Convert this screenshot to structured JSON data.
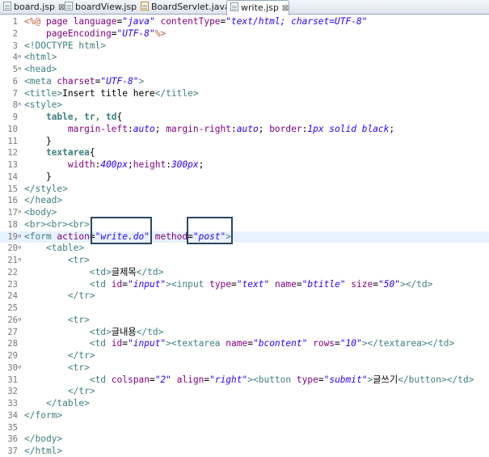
{
  "tabs": [
    {
      "name": "board.jsp",
      "close": "⊠",
      "type": "jsp"
    },
    {
      "name": "boardView.jsp",
      "close": "",
      "type": "jsp"
    },
    {
      "name": "BoardServlet.java",
      "close": "",
      "type": "java"
    },
    {
      "name": "write.jsp",
      "close": "⊠",
      "type": "jsp",
      "active": true
    }
  ],
  "editor": {
    "current_line": 19,
    "lines": [
      {
        "n": "1",
        "fold": "",
        "segs": [
          [
            "dir",
            "<%@ "
          ],
          [
            "atn",
            "page "
          ],
          [
            "atn",
            "language"
          ],
          [
            "txt",
            "="
          ],
          [
            "atv",
            "\"java\""
          ],
          [
            "txt",
            " "
          ],
          [
            "atn",
            "contentType"
          ],
          [
            "txt",
            "="
          ],
          [
            "atv",
            "\"text/html; charset=UTF-8\""
          ]
        ]
      },
      {
        "n": "2",
        "fold": "",
        "segs": [
          [
            "txt",
            "    "
          ],
          [
            "atn",
            "pageEncoding"
          ],
          [
            "txt",
            "="
          ],
          [
            "atv",
            "\"UTF-8\""
          ],
          [
            "dir",
            "%>"
          ]
        ]
      },
      {
        "n": "3",
        "fold": "",
        "segs": [
          [
            "tag",
            "<!DOCTYPE html>"
          ]
        ]
      },
      {
        "n": "4",
        "fold": "⊖",
        "segs": [
          [
            "tag",
            "<html>"
          ]
        ]
      },
      {
        "n": "5",
        "fold": "⊖",
        "segs": [
          [
            "tag",
            "<head>"
          ]
        ]
      },
      {
        "n": "6",
        "fold": "",
        "segs": [
          [
            "tag",
            "<meta "
          ],
          [
            "atn",
            "charset"
          ],
          [
            "txt",
            "="
          ],
          [
            "atv",
            "\"UTF-8\""
          ],
          [
            "tag",
            ">"
          ]
        ]
      },
      {
        "n": "7",
        "fold": "",
        "segs": [
          [
            "tag",
            "<title>"
          ],
          [
            "txt",
            "Insert title here"
          ],
          [
            "tag",
            "</title>"
          ]
        ]
      },
      {
        "n": "8",
        "fold": "⊖",
        "segs": [
          [
            "tag",
            "<style>"
          ]
        ]
      },
      {
        "n": "9",
        "fold": "",
        "segs": [
          [
            "txt",
            "    "
          ],
          [
            "css",
            "table, tr, td"
          ],
          [
            "txt",
            "{"
          ]
        ]
      },
      {
        "n": "10",
        "fold": "",
        "segs": [
          [
            "txt",
            "        "
          ],
          [
            "pn",
            "margin-left"
          ],
          [
            "txt",
            ":"
          ],
          [
            "pv",
            "auto"
          ],
          [
            "txt",
            "; "
          ],
          [
            "pn",
            "margin-right"
          ],
          [
            "txt",
            ":"
          ],
          [
            "pv",
            "auto"
          ],
          [
            "txt",
            "; "
          ],
          [
            "pn",
            "border"
          ],
          [
            "txt",
            ":"
          ],
          [
            "pv",
            "1px solid black"
          ],
          [
            "txt",
            ";"
          ]
        ]
      },
      {
        "n": "11",
        "fold": "",
        "segs": [
          [
            "txt",
            "    }"
          ]
        ]
      },
      {
        "n": "12",
        "fold": "",
        "segs": [
          [
            "txt",
            "    "
          ],
          [
            "css",
            "textarea"
          ],
          [
            "txt",
            "{"
          ]
        ]
      },
      {
        "n": "13",
        "fold": "",
        "segs": [
          [
            "txt",
            "        "
          ],
          [
            "pn",
            "width"
          ],
          [
            "txt",
            ":"
          ],
          [
            "pv",
            "400px"
          ],
          [
            "txt",
            ";"
          ],
          [
            "pn",
            "height"
          ],
          [
            "txt",
            ":"
          ],
          [
            "pv",
            "300px"
          ],
          [
            "txt",
            ";"
          ]
        ]
      },
      {
        "n": "14",
        "fold": "",
        "segs": [
          [
            "txt",
            "    }"
          ]
        ]
      },
      {
        "n": "15",
        "fold": "",
        "segs": [
          [
            "tag",
            "</style>"
          ]
        ]
      },
      {
        "n": "16",
        "fold": "",
        "segs": [
          [
            "tag",
            "</head>"
          ]
        ]
      },
      {
        "n": "17",
        "fold": "⊖",
        "segs": [
          [
            "tag",
            "<body>"
          ]
        ]
      },
      {
        "n": "18",
        "fold": "",
        "segs": [
          [
            "tag",
            "<br><br><br>"
          ]
        ]
      },
      {
        "n": "19",
        "fold": "⊖",
        "segs": [
          [
            "tag",
            "<form "
          ],
          [
            "atn",
            "action"
          ],
          [
            "txt",
            "="
          ],
          [
            "atv",
            "\"write.do\""
          ],
          [
            "txt",
            " "
          ],
          [
            "atn",
            "method"
          ],
          [
            "txt",
            "="
          ],
          [
            "atv",
            "\"post\""
          ],
          [
            "tag",
            ">"
          ]
        ]
      },
      {
        "n": "20",
        "fold": "⊖",
        "segs": [
          [
            "txt",
            "    "
          ],
          [
            "tag",
            "<table>"
          ]
        ]
      },
      {
        "n": "21",
        "fold": "⊖",
        "segs": [
          [
            "txt",
            "        "
          ],
          [
            "tag",
            "<tr>"
          ]
        ]
      },
      {
        "n": "22",
        "fold": "",
        "segs": [
          [
            "txt",
            "            "
          ],
          [
            "tag",
            "<td>"
          ],
          [
            "txt",
            "글제목"
          ],
          [
            "tag",
            "</td>"
          ]
        ]
      },
      {
        "n": "23",
        "fold": "",
        "segs": [
          [
            "txt",
            "            "
          ],
          [
            "tag",
            "<td "
          ],
          [
            "atn",
            "id"
          ],
          [
            "txt",
            "="
          ],
          [
            "atv",
            "\"input\""
          ],
          [
            "tag",
            ">"
          ],
          [
            "tag",
            "<input "
          ],
          [
            "atn",
            "type"
          ],
          [
            "txt",
            "="
          ],
          [
            "atv",
            "\"text\""
          ],
          [
            "txt",
            " "
          ],
          [
            "atn",
            "name"
          ],
          [
            "txt",
            "="
          ],
          [
            "atv",
            "\"btitle\""
          ],
          [
            "txt",
            " "
          ],
          [
            "atn",
            "size"
          ],
          [
            "txt",
            "="
          ],
          [
            "atv",
            "\"50\""
          ],
          [
            "tag",
            ">"
          ],
          [
            "tag",
            "</td>"
          ]
        ]
      },
      {
        "n": "24",
        "fold": "",
        "segs": [
          [
            "txt",
            "        "
          ],
          [
            "tag",
            "</tr>"
          ]
        ]
      },
      {
        "n": "25",
        "fold": "",
        "segs": []
      },
      {
        "n": "26",
        "fold": "⊖",
        "segs": [
          [
            "txt",
            "        "
          ],
          [
            "tag",
            "<tr>"
          ]
        ]
      },
      {
        "n": "27",
        "fold": "",
        "segs": [
          [
            "txt",
            "            "
          ],
          [
            "tag",
            "<td>"
          ],
          [
            "txt",
            "글내용"
          ],
          [
            "tag",
            "</td>"
          ]
        ]
      },
      {
        "n": "28",
        "fold": "",
        "segs": [
          [
            "txt",
            "            "
          ],
          [
            "tag",
            "<td "
          ],
          [
            "atn",
            "id"
          ],
          [
            "txt",
            "="
          ],
          [
            "atv",
            "\"input\""
          ],
          [
            "tag",
            ">"
          ],
          [
            "tag",
            "<textarea "
          ],
          [
            "atn",
            "name"
          ],
          [
            "txt",
            "="
          ],
          [
            "atv",
            "\"bcontent\""
          ],
          [
            "txt",
            " "
          ],
          [
            "atn",
            "rows"
          ],
          [
            "txt",
            "="
          ],
          [
            "atv",
            "\"10\""
          ],
          [
            "tag",
            ">"
          ],
          [
            "tag",
            "</textarea>"
          ],
          [
            "tag",
            "</td>"
          ]
        ]
      },
      {
        "n": "29",
        "fold": "",
        "segs": [
          [
            "txt",
            "        "
          ],
          [
            "tag",
            "</tr>"
          ]
        ]
      },
      {
        "n": "30",
        "fold": "⊖",
        "segs": [
          [
            "txt",
            "        "
          ],
          [
            "tag",
            "<tr>"
          ]
        ]
      },
      {
        "n": "31",
        "fold": "",
        "segs": [
          [
            "txt",
            "            "
          ],
          [
            "tag",
            "<td "
          ],
          [
            "atn",
            "colspan"
          ],
          [
            "txt",
            "="
          ],
          [
            "atv",
            "\"2\""
          ],
          [
            "txt",
            " "
          ],
          [
            "atn",
            "align"
          ],
          [
            "txt",
            "="
          ],
          [
            "atv",
            "\"right\""
          ],
          [
            "tag",
            ">"
          ],
          [
            "tag",
            "<button "
          ],
          [
            "atn",
            "type"
          ],
          [
            "txt",
            "="
          ],
          [
            "atv",
            "\"submit\""
          ],
          [
            "tag",
            ">"
          ],
          [
            "txt",
            "글쓰기"
          ],
          [
            "tag",
            "</button>"
          ],
          [
            "tag",
            "</td>"
          ]
        ]
      },
      {
        "n": "32",
        "fold": "",
        "segs": [
          [
            "txt",
            "        "
          ],
          [
            "tag",
            "</tr>"
          ]
        ]
      },
      {
        "n": "33",
        "fold": "",
        "segs": [
          [
            "txt",
            "    "
          ],
          [
            "tag",
            "</table>"
          ]
        ]
      },
      {
        "n": "34",
        "fold": "",
        "segs": [
          [
            "tag",
            "</form>"
          ]
        ]
      },
      {
        "n": "35",
        "fold": "",
        "segs": []
      },
      {
        "n": "36",
        "fold": "",
        "segs": [
          [
            "tag",
            "</body>"
          ]
        ]
      },
      {
        "n": "37",
        "fold": "",
        "segs": [
          [
            "tag",
            "</html>"
          ]
        ]
      }
    ]
  },
  "colors": {
    "tag": "#3f7f7f",
    "attribute_name": "#7f007f",
    "attribute_value": "#2a00ff",
    "jsp_directive": "#bf5f3f",
    "current_line_bg": "#e8f2fe",
    "highlight_box": "#2d4663"
  }
}
